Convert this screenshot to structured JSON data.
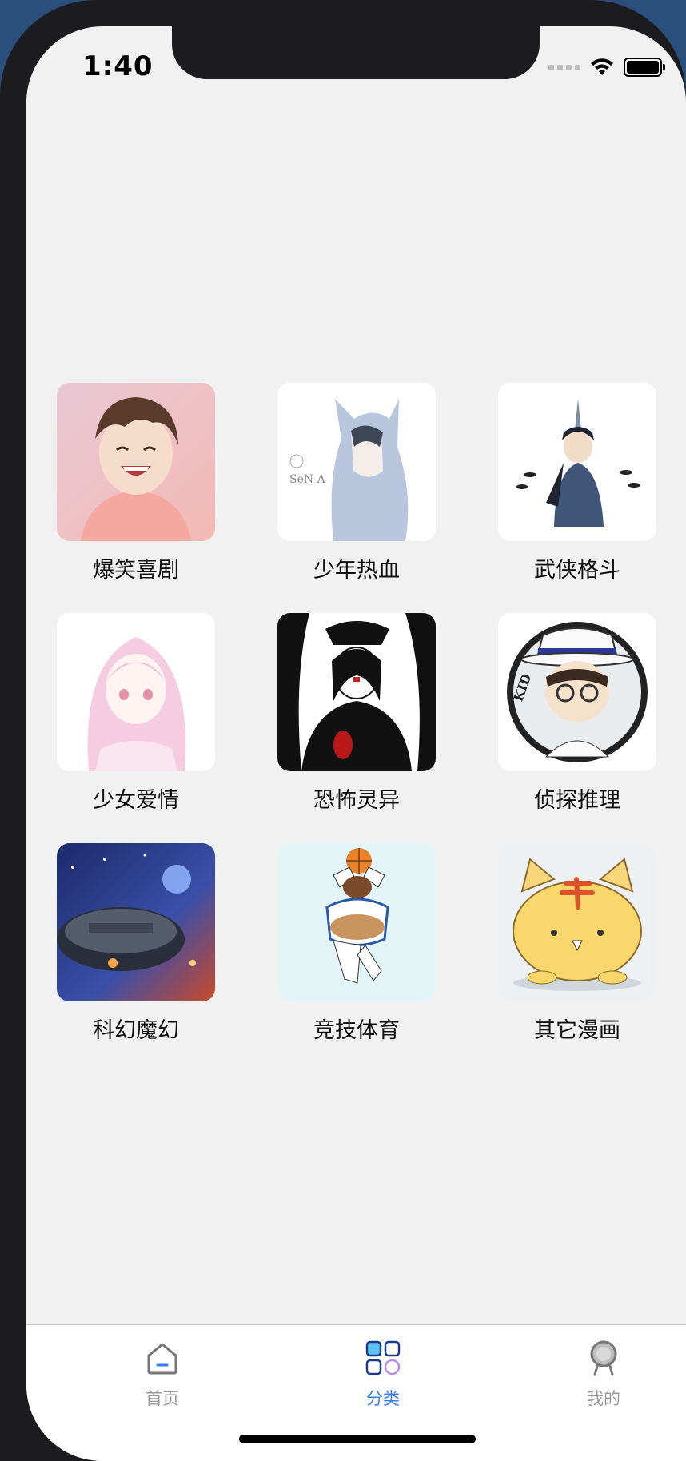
{
  "status_bar": {
    "time": "1:40"
  },
  "categories": [
    {
      "label": "爆笑喜剧",
      "icon": "laughing-boy-thumbnail"
    },
    {
      "label": "少年热血",
      "icon": "hooded-boy-thumbnail"
    },
    {
      "label": "武侠格斗",
      "icon": "martial-warrior-thumbnail"
    },
    {
      "label": "少女爱情",
      "icon": "pink-girl-thumbnail"
    },
    {
      "label": "恐怖灵异",
      "icon": "horror-figure-thumbnail"
    },
    {
      "label": "侦探推理",
      "icon": "detective-kid-thumbnail"
    },
    {
      "label": "科幻魔幻",
      "icon": "spaceship-thumbnail"
    },
    {
      "label": "竞技体育",
      "icon": "basketball-player-thumbnail"
    },
    {
      "label": "其它漫画",
      "icon": "yellow-cat-thumbnail"
    }
  ],
  "tabbar": {
    "items": [
      {
        "label": "首页",
        "icon": "home-icon",
        "active": false
      },
      {
        "label": "分类",
        "icon": "category-grid-icon",
        "active": true
      },
      {
        "label": "我的",
        "icon": "profile-icon",
        "active": false
      }
    ],
    "active_color": "#3a7df2",
    "inactive_color": "#999999"
  }
}
